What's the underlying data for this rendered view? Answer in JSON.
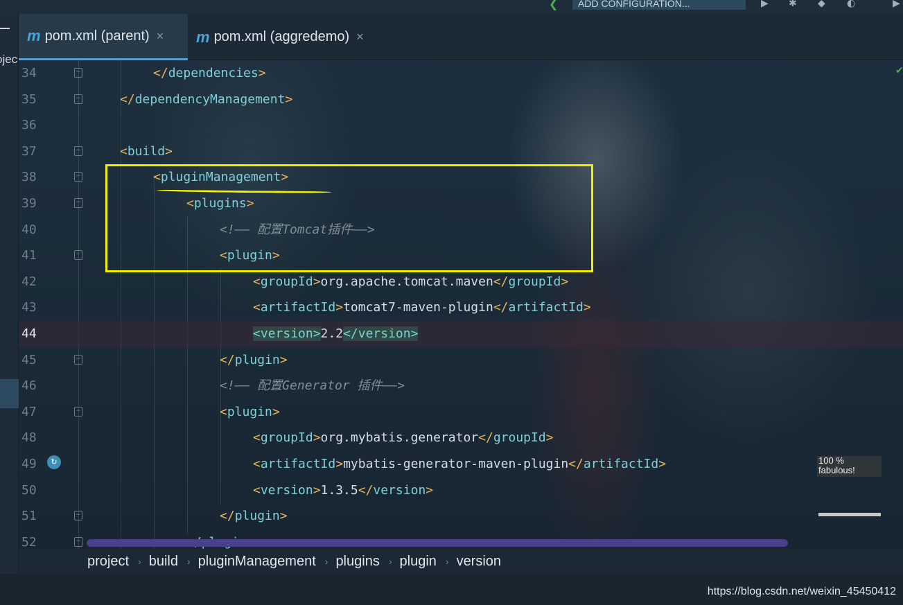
{
  "toolbar": {
    "run_config_label": "ADD CONFIGURATION..."
  },
  "left_panel": {
    "project_label": "ojec"
  },
  "tabs": [
    {
      "icon": "m",
      "label": "pom.xml (parent)",
      "close": "×"
    },
    {
      "icon": "m",
      "label": "pom.xml (aggredemo)",
      "close": "×"
    }
  ],
  "editor": {
    "lines": [
      {
        "n": "34",
        "indent": 2,
        "parts": [
          [
            "br",
            "</"
          ],
          [
            "tag",
            "dependencies"
          ],
          [
            "br",
            ">"
          ]
        ]
      },
      {
        "n": "35",
        "indent": 1,
        "parts": [
          [
            "br",
            "</"
          ],
          [
            "tag",
            "dependencyManagement"
          ],
          [
            "br",
            ">"
          ]
        ]
      },
      {
        "n": "36",
        "indent": 0,
        "parts": []
      },
      {
        "n": "37",
        "indent": 1,
        "parts": [
          [
            "br",
            "<"
          ],
          [
            "tag",
            "build"
          ],
          [
            "br",
            ">"
          ]
        ]
      },
      {
        "n": "38",
        "indent": 2,
        "parts": [
          [
            "br",
            "<"
          ],
          [
            "tag",
            "pluginManagement"
          ],
          [
            "br",
            ">"
          ]
        ]
      },
      {
        "n": "39",
        "indent": 3,
        "parts": [
          [
            "br",
            "<"
          ],
          [
            "tag",
            "plugins"
          ],
          [
            "br",
            ">"
          ]
        ]
      },
      {
        "n": "40",
        "indent": 4,
        "parts": [
          [
            "cm",
            "<!—— 配置Tomcat插件——>"
          ]
        ]
      },
      {
        "n": "41",
        "indent": 4,
        "parts": [
          [
            "br",
            "<"
          ],
          [
            "tag",
            "plugin"
          ],
          [
            "br",
            ">"
          ]
        ]
      },
      {
        "n": "42",
        "indent": 5,
        "parts": [
          [
            "br",
            "<"
          ],
          [
            "tag",
            "groupId"
          ],
          [
            "br",
            ">"
          ],
          [
            "txt",
            "org.apache.tomcat.maven"
          ],
          [
            "br",
            "</"
          ],
          [
            "tag",
            "groupId"
          ],
          [
            "br",
            ">"
          ]
        ]
      },
      {
        "n": "43",
        "indent": 5,
        "parts": [
          [
            "br",
            "<"
          ],
          [
            "tag",
            "artifactId"
          ],
          [
            "br",
            ">"
          ],
          [
            "txt",
            "tomcat7-maven-plugin"
          ],
          [
            "br",
            "</"
          ],
          [
            "tag",
            "artifactId"
          ],
          [
            "br",
            ">"
          ]
        ]
      },
      {
        "n": "44",
        "indent": 5,
        "current": true,
        "parts": [
          [
            "brv",
            "<"
          ],
          [
            "tagv",
            "version"
          ],
          [
            "brv",
            ">"
          ],
          [
            "txt",
            "2.2"
          ],
          [
            "brv",
            "</"
          ],
          [
            "tagv",
            "version"
          ],
          [
            "brv",
            ">"
          ]
        ]
      },
      {
        "n": "45",
        "indent": 4,
        "parts": [
          [
            "br",
            "</"
          ],
          [
            "tag",
            "plugin"
          ],
          [
            "br",
            ">"
          ]
        ]
      },
      {
        "n": "46",
        "indent": 4,
        "parts": [
          [
            "cm",
            "<!—— 配置Generator 插件——>"
          ]
        ]
      },
      {
        "n": "47",
        "indent": 4,
        "parts": [
          [
            "br",
            "<"
          ],
          [
            "tag",
            "plugin"
          ],
          [
            "br",
            ">"
          ]
        ]
      },
      {
        "n": "48",
        "indent": 5,
        "parts": [
          [
            "br",
            "<"
          ],
          [
            "tag",
            "groupId"
          ],
          [
            "br",
            ">"
          ],
          [
            "txt",
            "org.mybatis.generator"
          ],
          [
            "br",
            "</"
          ],
          [
            "tag",
            "groupId"
          ],
          [
            "br",
            ">"
          ]
        ]
      },
      {
        "n": "49",
        "indent": 5,
        "parts": [
          [
            "br",
            "<"
          ],
          [
            "tag",
            "artifactId"
          ],
          [
            "br",
            ">"
          ],
          [
            "txt",
            "mybatis-generator-maven-plugin"
          ],
          [
            "br",
            "</"
          ],
          [
            "tag",
            "artifactId"
          ],
          [
            "br",
            ">"
          ]
        ]
      },
      {
        "n": "50",
        "indent": 5,
        "parts": [
          [
            "br",
            "<"
          ],
          [
            "tag",
            "version"
          ],
          [
            "br",
            ">"
          ],
          [
            "txt",
            "1.3.5"
          ],
          [
            "br",
            "</"
          ],
          [
            "tag",
            "version"
          ],
          [
            "br",
            ">"
          ]
        ]
      },
      {
        "n": "51",
        "indent": 4,
        "parts": [
          [
            "br",
            "</"
          ],
          [
            "tag",
            "plugin"
          ],
          [
            "br",
            ">"
          ]
        ]
      },
      {
        "n": "52",
        "indent": 3,
        "parts": [
          [
            "br",
            "</"
          ],
          [
            "tag",
            "plugins"
          ],
          [
            "br",
            ">"
          ]
        ]
      }
    ]
  },
  "overlay": {
    "zoom_line1": "100 %",
    "zoom_line2": "fabulous!"
  },
  "breadcrumb": [
    "project",
    "build",
    "pluginManagement",
    "plugins",
    "plugin",
    "version"
  ],
  "breadcrumb_sep": "›",
  "watermark": "https://blog.csdn.net/weixin_45450412",
  "colors": {
    "highlight_box": "#f2f000",
    "accent": "#4aa3d8",
    "scrollbar": "#4a3f8a"
  }
}
